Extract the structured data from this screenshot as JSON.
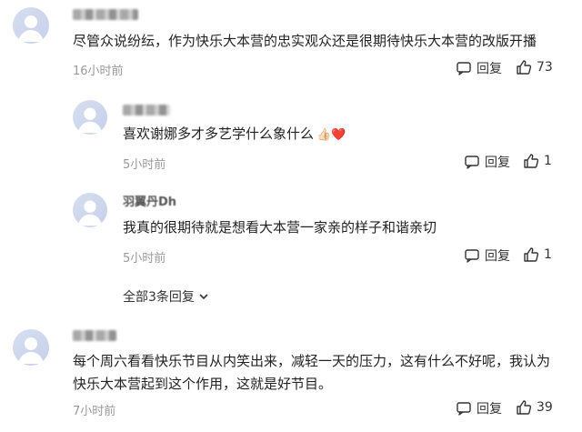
{
  "comments": [
    {
      "text": "尽管众说纷纭，作为快乐大本营的忠实观众还是很期待快乐大本营的改版开播",
      "time": "16小时前",
      "reply_label": "回复",
      "likes": "73"
    },
    {
      "text": "喜欢谢娜多才多艺学什么象什么",
      "emoji": "👍🏻❤️",
      "time": "5小时前",
      "reply_label": "回复",
      "likes": "1"
    },
    {
      "name": "羽翼丹Dh",
      "text": "我真的很期待就是想看大本营一家亲的样子和谐亲切",
      "time": "5小时前",
      "reply_label": "回复",
      "likes": "1"
    },
    {
      "text": "每个周六看看快乐节目从内笑出来，减轻一天的压力，这有什么不好呢，我认为快乐大本营起到这个作用，这就是好节目。",
      "time": "7小时前",
      "reply_label": "回复",
      "likes": "39"
    }
  ],
  "replies_toggle": "全部3条回复",
  "colors": {
    "text": "#222222",
    "muted": "#999999",
    "avatar": "#d7def0"
  }
}
